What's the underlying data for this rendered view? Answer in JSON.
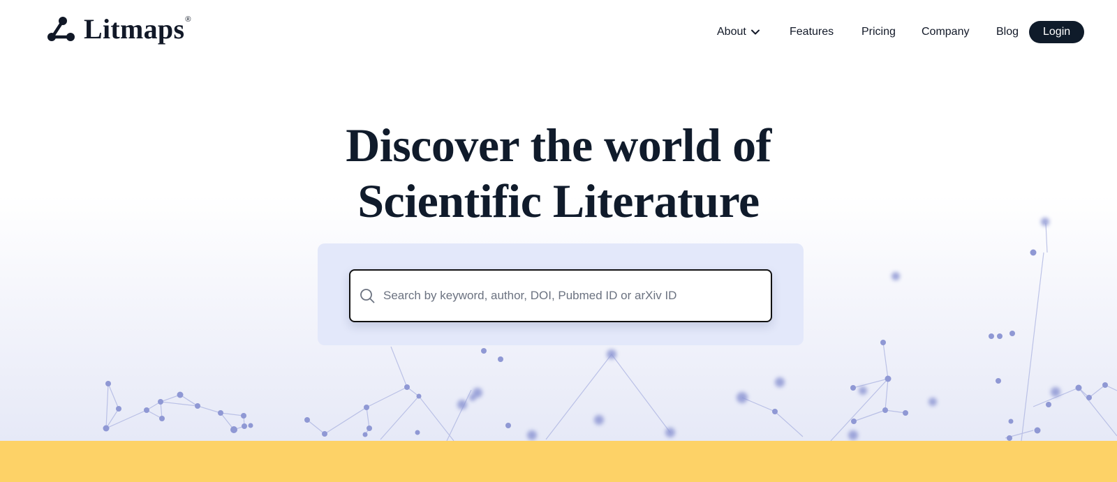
{
  "brand": {
    "name": "Litmaps",
    "registered_mark": "®"
  },
  "nav": {
    "items": [
      {
        "label": "About",
        "has_dropdown": true
      },
      {
        "label": "Features"
      },
      {
        "label": "Pricing"
      },
      {
        "label": "Company"
      },
      {
        "label": "Blog"
      }
    ],
    "login_label": "Login"
  },
  "hero": {
    "headline_line1": "Discover the world of",
    "headline_line2": "Scientific Literature"
  },
  "search": {
    "placeholder": "Search by keyword, author, DOI, Pubmed ID or arXiv ID",
    "value": "",
    "icon": "search-icon"
  },
  "colors": {
    "text_dark": "#111827",
    "login_bg": "#0f1b2a",
    "search_panel_bg": "#e3e8fa",
    "network_node": "#8f98d4",
    "footer_band": "#fdd267"
  }
}
